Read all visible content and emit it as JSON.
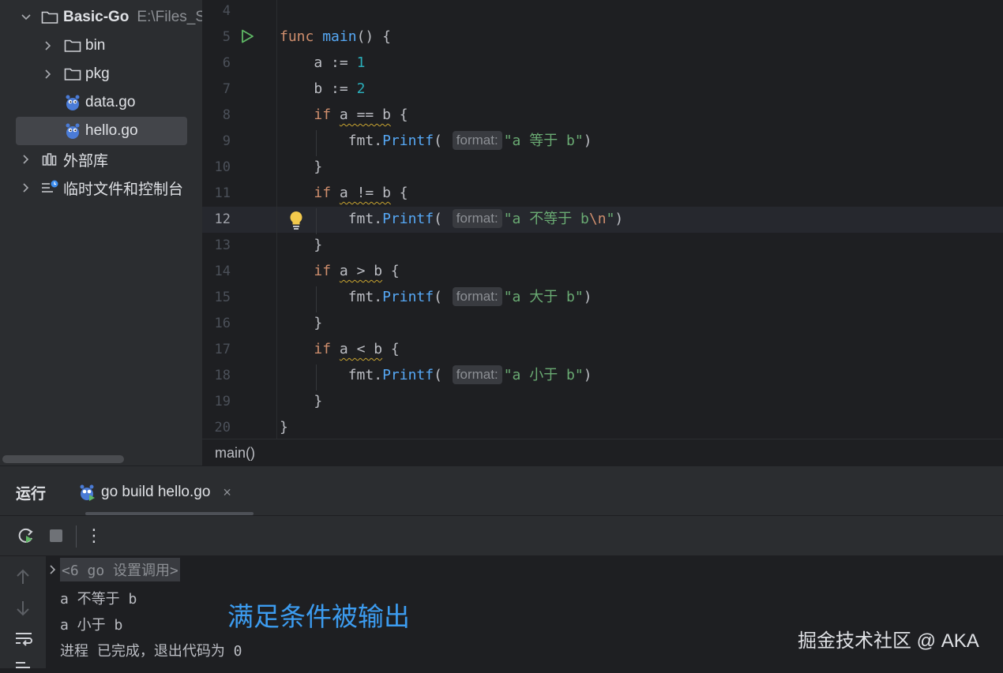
{
  "project_tree": {
    "root": {
      "name": "Basic-Go",
      "path": "E:\\Files_So"
    },
    "items": [
      {
        "label": "bin",
        "type": "folder"
      },
      {
        "label": "pkg",
        "type": "folder"
      },
      {
        "label": "data.go",
        "type": "go-file"
      },
      {
        "label": "hello.go",
        "type": "go-file",
        "selected": true
      },
      {
        "label": "外部库",
        "type": "library"
      },
      {
        "label": "临时文件和控制台",
        "type": "scratches"
      }
    ]
  },
  "editor": {
    "line_numbers": [
      "4",
      "5",
      "6",
      "7",
      "8",
      "9",
      "10",
      "11",
      "12",
      "13",
      "14",
      "15",
      "16",
      "17",
      "18",
      "19",
      "20"
    ],
    "current_line": "12",
    "hint_label": "format:",
    "lines": {
      "l5": {
        "kw": "func",
        "name": "main",
        "rest": "() {"
      },
      "l6": {
        "var": "a",
        "op": " := ",
        "val": "1"
      },
      "l7": {
        "var": "b",
        "op": " := ",
        "val": "2"
      },
      "l8": {
        "kw": "if",
        "cond": "a == b",
        "rest": " {"
      },
      "l9": {
        "pkg": "fmt",
        "call": "Printf",
        "str": "\"a 等于 b\""
      },
      "l10": {
        "text": "}"
      },
      "l11": {
        "kw": "if",
        "cond": "a != b",
        "rest": " {"
      },
      "l12": {
        "pkg": "fmt",
        "call": "Printf",
        "str": "\"a 不等于 b",
        "esc": "\\n",
        "str_end": "\""
      },
      "l13": {
        "text": "}"
      },
      "l14": {
        "kw": "if",
        "cond": "a > b",
        "rest": " {"
      },
      "l15": {
        "pkg": "fmt",
        "call": "Printf",
        "str": "\"a 大于 b\""
      },
      "l16": {
        "text": "}"
      },
      "l17": {
        "kw": "if",
        "cond": "a < b",
        "rest": " {"
      },
      "l18": {
        "pkg": "fmt",
        "call": "Printf",
        "str": "\"a 小于 b\""
      },
      "l19": {
        "text": "}"
      },
      "l20": {
        "text": "}"
      }
    },
    "breadcrumb": "main()"
  },
  "run_panel": {
    "title": "运行",
    "tab_label": "go build hello.go",
    "tab_close": "×",
    "toolbar": {
      "more": "⋮"
    },
    "console": {
      "command": "<6 go 设置调用>",
      "output": [
        "a 不等于 b",
        "a 小于 b",
        "进程 已完成，退出代码为 0"
      ]
    }
  },
  "overlay": {
    "annotation": "满足条件被输出",
    "watermark": "掘金技术社区 @ AKA"
  },
  "colors": {
    "keyword": "#cf8e6d",
    "function": "#56a8f5",
    "number": "#2aacb8",
    "string": "#6aab73",
    "annotation": "#3c9cf0"
  }
}
